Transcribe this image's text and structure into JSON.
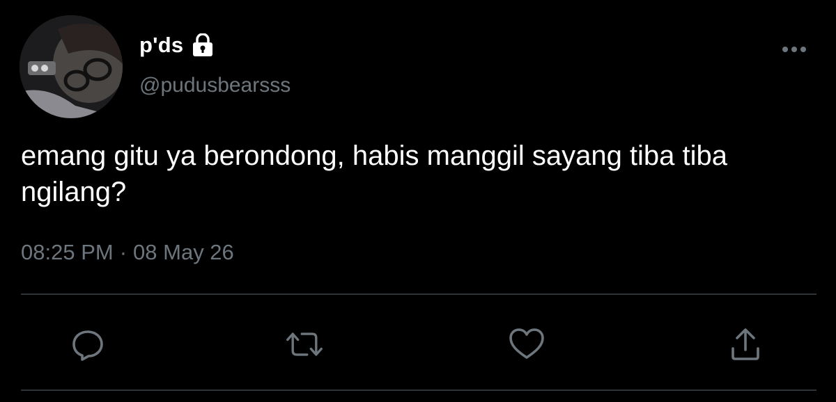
{
  "author": {
    "display_name": "p'ds",
    "handle": "@pudusbearsss",
    "protected_icon": "lock-icon",
    "avatar": "profile-photo"
  },
  "tweet": {
    "text": "emang gitu ya berondong, habis manggil sayang tiba tiba ngilang?",
    "time": "08:25 PM",
    "separator": "·",
    "date": "08 May 26"
  },
  "menu": {
    "icon": "more-icon"
  },
  "actions": [
    {
      "name": "reply",
      "icon": "reply-icon"
    },
    {
      "name": "retweet",
      "icon": "retweet-icon"
    },
    {
      "name": "like",
      "icon": "heart-icon"
    },
    {
      "name": "share",
      "icon": "share-icon"
    }
  ],
  "colors": {
    "background": "#000000",
    "text": "#ffffff",
    "secondary_text": "#6e767d",
    "divider": "#2f3336",
    "icon": "#6e767d"
  }
}
